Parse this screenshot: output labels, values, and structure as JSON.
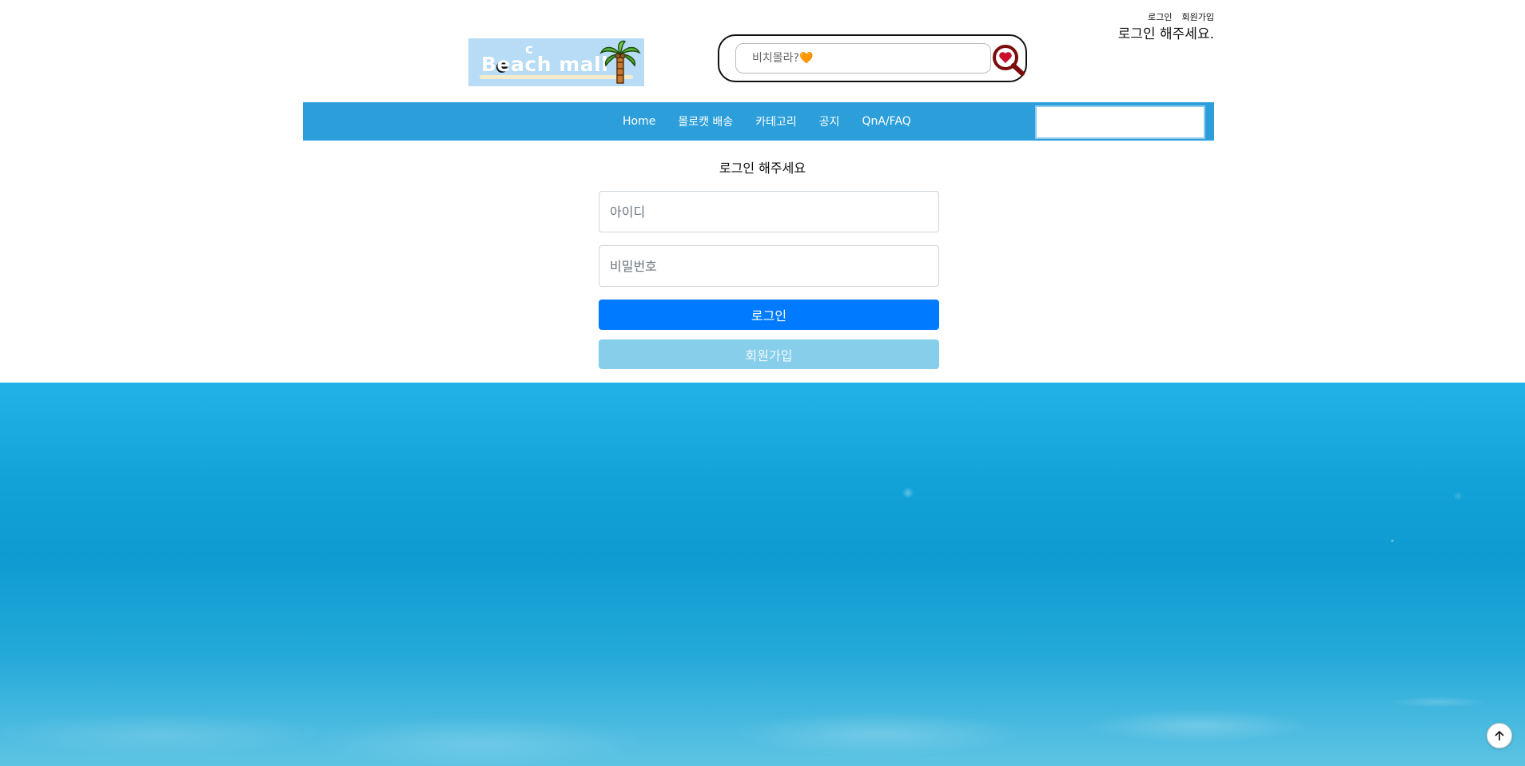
{
  "header": {
    "util_links": [
      "로그인",
      "회원가입"
    ],
    "greeting": "로그인 해주세요.",
    "logo": {
      "text": "Beach mall",
      "icon": "palm-tree-icon",
      "bg_color": "#b8dcf6"
    },
    "search": {
      "placeholder": "비치몰라?🧡",
      "icon": "heart-magnifier-icon"
    }
  },
  "nav": {
    "bg_color": "#2c9fdb",
    "items": [
      "Home",
      "몰로캣 배송",
      "카테고리",
      "공지",
      "QnA/FAQ"
    ]
  },
  "login_form": {
    "title": "로그인 해주세요",
    "id_placeholder": "아이디",
    "password_placeholder": "비밀번호",
    "login_label": "로그인",
    "signup_label": "회원가입",
    "login_color": "#007bff",
    "signup_color": "#87ceeb"
  },
  "footer": {
    "scroll_top_icon": "arrow-up-icon"
  }
}
